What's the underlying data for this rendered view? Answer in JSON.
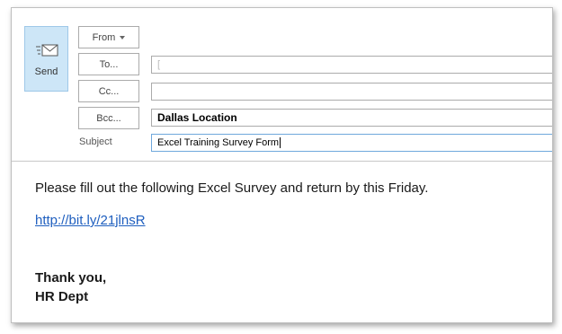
{
  "compose": {
    "send_label": "Send",
    "from_label": "From",
    "to_label": "To...",
    "cc_label": "Cc...",
    "bcc_label": "Bcc...",
    "subject_label": "Subject",
    "to_value": "",
    "to_placeholder": "[",
    "cc_value": "",
    "bcc_value": "Dallas Location",
    "subject_value": "Excel Training Survey Form"
  },
  "message": {
    "line1": "Please fill out the following Excel Survey and return by this Friday.",
    "link": "http://bit.ly/21jlnsR",
    "closing": "Thank you,",
    "signature": "HR Dept"
  },
  "colors": {
    "send_button_bg": "#cde6f7",
    "link": "#1f5fbf"
  }
}
